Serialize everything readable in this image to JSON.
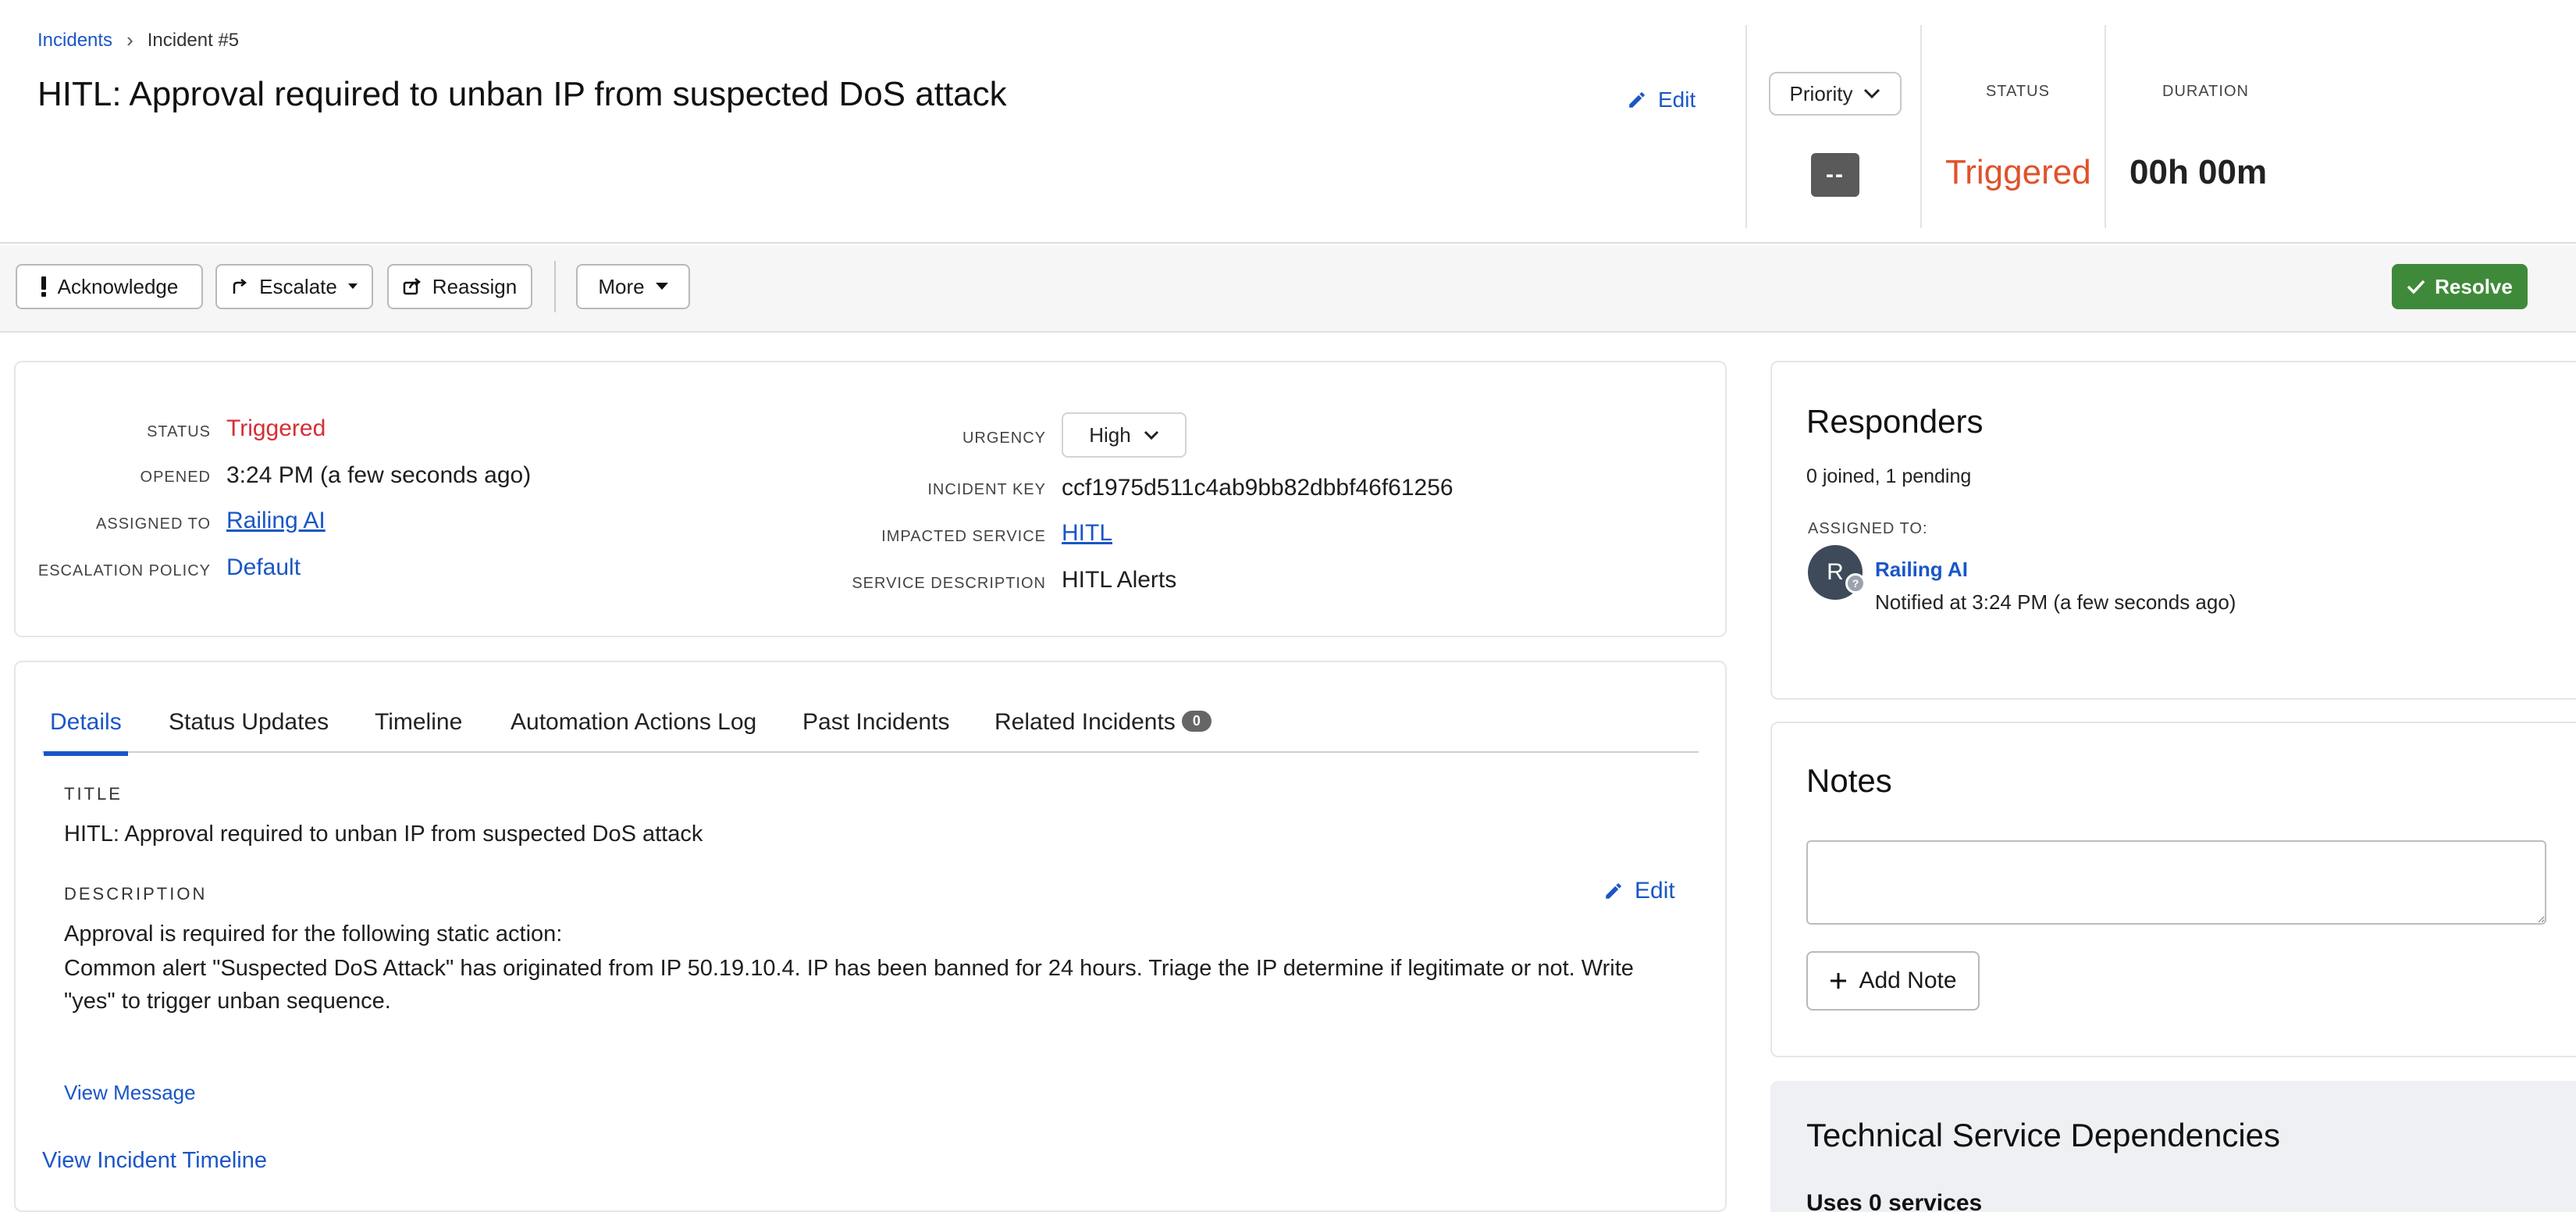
{
  "breadcrumb": {
    "root": "Incidents",
    "separator": "›",
    "current": "Incident #5"
  },
  "header": {
    "title": "HITL: Approval required to unban IP from suspected DoS attack",
    "edit_label": "Edit",
    "priority_label": "Priority",
    "priority_value": "--",
    "status_label": "STATUS",
    "status_value": "Triggered",
    "duration_label": "DURATION",
    "duration_value": "00h 00m"
  },
  "toolbar": {
    "acknowledge": "Acknowledge",
    "escalate": "Escalate",
    "reassign": "Reassign",
    "more": "More",
    "resolve": "Resolve"
  },
  "summary": {
    "status_label": "STATUS",
    "status_value": "Triggered",
    "opened_label": "OPENED",
    "opened_value": "3:24 PM (a few seconds ago)",
    "assigned_label": "ASSIGNED TO",
    "assigned_value": "Railing AI",
    "escalation_label": "ESCALATION POLICY",
    "escalation_value": "Default",
    "urgency_label": "URGENCY",
    "urgency_value": "High",
    "key_label": "INCIDENT KEY",
    "key_value": "ccf1975d511c4ab9bb82dbbf46f61256",
    "service_label": "IMPACTED SERVICE",
    "service_value": "HITL",
    "service_desc_label": "SERVICE DESCRIPTION",
    "service_desc_value": "HITL Alerts"
  },
  "tabs": {
    "details": "Details",
    "status_updates": "Status Updates",
    "timeline": "Timeline",
    "automation": "Automation Actions Log",
    "past": "Past Incidents",
    "related": "Related Incidents",
    "related_count": "0"
  },
  "details": {
    "title_label": "TITLE",
    "title_value": "HITL: Approval required to unban IP from suspected DoS attack",
    "description_label": "DESCRIPTION",
    "edit_label": "Edit",
    "description_line1": "Approval is required for the following static action:",
    "description_line2": "Common alert \"Suspected DoS Attack\" has originated from IP 50.19.10.4. IP has been banned for 24 hours. Triage the IP determine if legitimate or not. Write",
    "description_line3": "\"yes\" to trigger unban sequence.",
    "view_message": "View Message",
    "view_timeline": "View Incident Timeline"
  },
  "responders": {
    "title": "Responders",
    "summary": "0 joined, 1 pending",
    "assigned_label": "ASSIGNED TO:",
    "avatar_initial": "R",
    "avatar_status": "?",
    "name": "Railing AI",
    "notified": "Notified at 3:24 PM (a few seconds ago)"
  },
  "notes": {
    "title": "Notes",
    "placeholder": "",
    "add_button": "Add Note"
  },
  "tech_deps": {
    "title": "Technical Service Dependencies",
    "subtitle": "Uses 0 services"
  },
  "colors": {
    "link": "#1a56c7",
    "triggered_header": "#e0522b",
    "triggered_field": "#d42f34",
    "resolve": "#3f8a3a"
  }
}
